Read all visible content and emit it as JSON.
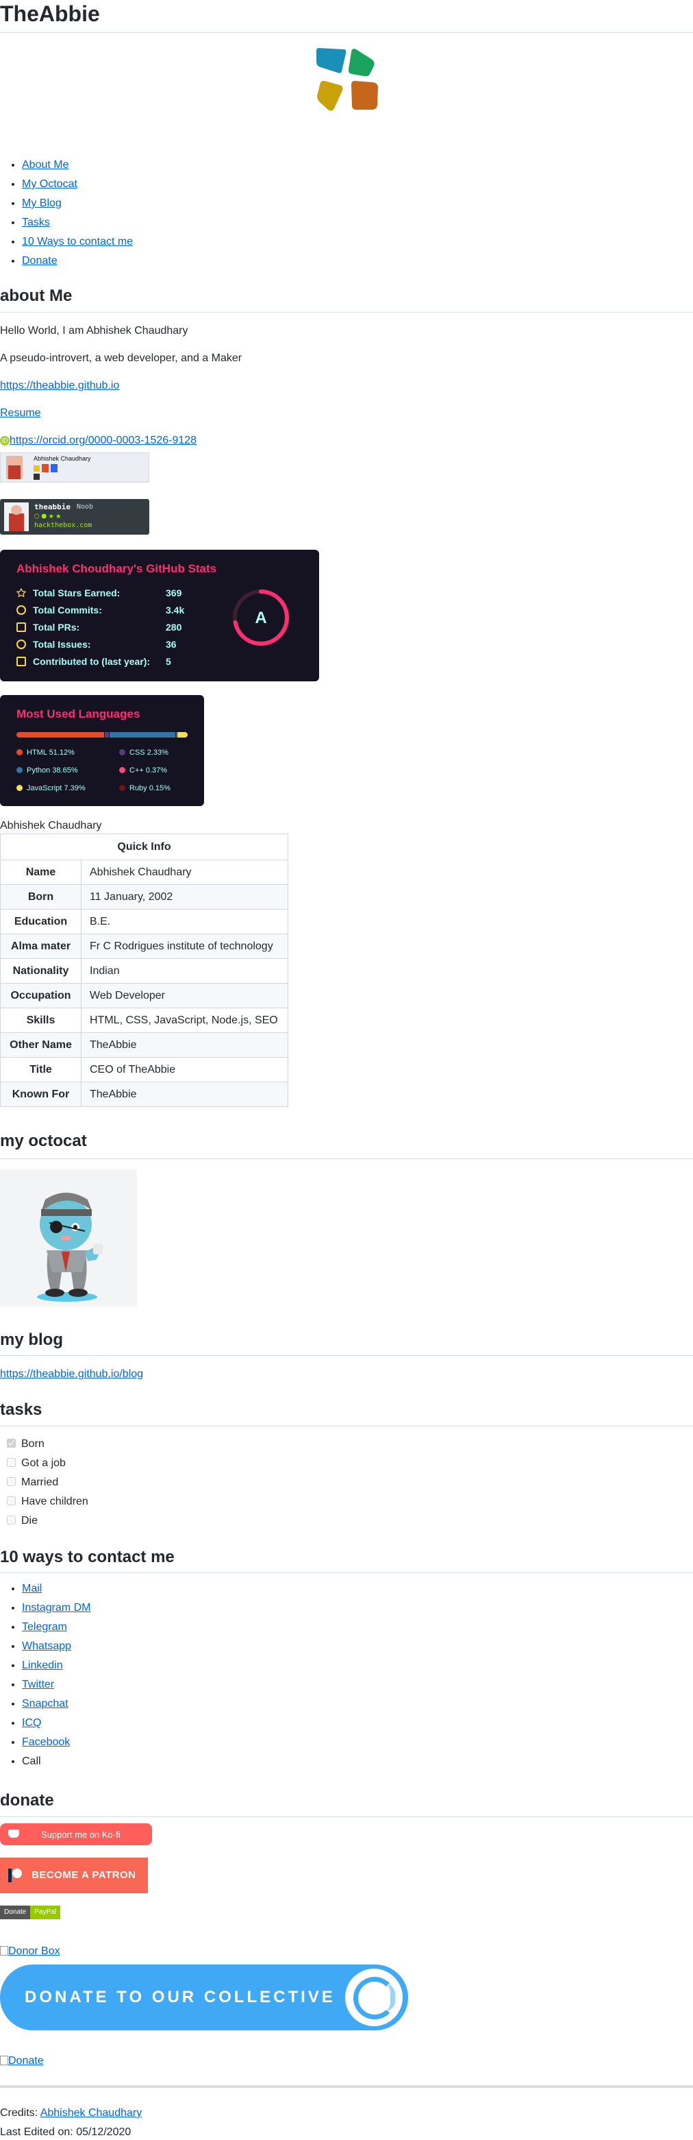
{
  "site_title": "TheAbbie",
  "nav": [
    "About Me",
    "My Octocat",
    "My Blog",
    "Tasks",
    "10 Ways to contact me",
    "Donate"
  ],
  "about": {
    "title": "about Me",
    "greeting": "Hello World, I am Abhishek Chaudhary",
    "tagline": "A pseudo-introvert, a web developer, and a Maker",
    "website": "https://theabbie.github.io",
    "resume": "Resume",
    "orcid": "https://orcid.org/0000-0003-1526-9128"
  },
  "badges": {
    "stackoverflow_name": "Abhishek Chaudhary",
    "htb_user": "theabbie",
    "htb_rank": "Noob",
    "htb_site": "hackthebox.com"
  },
  "github_stats": {
    "title": "Abhishek Choudhary's GitHub Stats",
    "grade": "A",
    "grade_progress": 0.72,
    "rows": [
      {
        "label": "Total Stars Earned:",
        "value": "369"
      },
      {
        "label": "Total Commits:",
        "value": "3.4k"
      },
      {
        "label": "Total PRs:",
        "value": "280"
      },
      {
        "label": "Total Issues:",
        "value": "36"
      },
      {
        "label": "Contributed to (last year):",
        "value": "5"
      }
    ],
    "colors": {
      "bg": "#151321",
      "title": "#fc2f70",
      "text": "#a9fef7",
      "icon": "#f8d847"
    }
  },
  "languages": {
    "title": "Most Used Languages",
    "items": [
      {
        "name": "HTML",
        "pct": "51.12%",
        "value": 51.12,
        "color": "#e34c26"
      },
      {
        "name": "CSS",
        "pct": "2.33%",
        "value": 2.33,
        "color": "#563d7c"
      },
      {
        "name": "Python",
        "pct": "38.65%",
        "value": 38.65,
        "color": "#3572a5"
      },
      {
        "name": "C++",
        "pct": "0.37%",
        "value": 0.37,
        "color": "#f34b7d"
      },
      {
        "name": "JavaScript",
        "pct": "7.39%",
        "value": 7.39,
        "color": "#f1e05a"
      },
      {
        "name": "Ruby",
        "pct": "0.15%",
        "value": 0.15,
        "color": "#701516"
      }
    ]
  },
  "quick_info": {
    "owner": "Abhishek Chaudhary",
    "caption": "Quick Info",
    "rows": [
      {
        "label": "Name",
        "value": "Abhishek Chaudhary"
      },
      {
        "label": "Born",
        "value": "11 January, 2002"
      },
      {
        "label": "Education",
        "value": "B.E."
      },
      {
        "label": "Alma mater",
        "value": "Fr C Rodrigues institute of technology"
      },
      {
        "label": "Nationality",
        "value": "Indian"
      },
      {
        "label": "Occupation",
        "value": "Web Developer"
      },
      {
        "label": "Skills",
        "value": "HTML, CSS, JavaScript, Node.js, SEO"
      },
      {
        "label": "Other Name",
        "value": "TheAbbie"
      },
      {
        "label": "Title",
        "value": "CEO of TheAbbie"
      },
      {
        "label": "Known For",
        "value": "TheAbbie"
      }
    ]
  },
  "octocat": {
    "title": "my octocat"
  },
  "blog": {
    "title": "my blog",
    "link": "https://theabbie.github.io/blog"
  },
  "tasks": {
    "title": "tasks",
    "items": [
      {
        "label": "Born",
        "checked": true
      },
      {
        "label": "Got a job",
        "checked": false
      },
      {
        "label": "Married",
        "checked": false
      },
      {
        "label": "Have children",
        "checked": false
      },
      {
        "label": "Die",
        "checked": false
      }
    ]
  },
  "contact": {
    "title": "10 ways to contact me",
    "items": [
      {
        "label": "Mail",
        "link": true
      },
      {
        "label": "Instagram DM",
        "link": true
      },
      {
        "label": "Telegram",
        "link": true
      },
      {
        "label": "Whatsapp",
        "link": true
      },
      {
        "label": "Linkedin",
        "link": true
      },
      {
        "label": "Twitter",
        "link": true
      },
      {
        "label": "Snapchat",
        "link": true
      },
      {
        "label": "ICQ",
        "link": true
      },
      {
        "label": "Facebook",
        "link": true
      },
      {
        "label": "Call",
        "link": false
      }
    ]
  },
  "donate": {
    "title": "donate",
    "kofi": "Support me on Ko-fi",
    "patreon": "BECOME A PATRON",
    "paypal_left": "Donate",
    "paypal_right": "PayPal",
    "donorbox_alt": "Donor Box",
    "collective": "DONATE TO OUR COLLECTIVE",
    "donate_alt": "Donate"
  },
  "footer": {
    "credits_prefix": "Credits:",
    "credits_name": "Abhishek Chaudhary",
    "last_edited": "Last Edited on: 05/12/2020"
  },
  "colors": {
    "link": "#0366d6",
    "logo": [
      "#1a8fb8",
      "#1aa35c",
      "#c9a20a",
      "#c6661a"
    ]
  }
}
